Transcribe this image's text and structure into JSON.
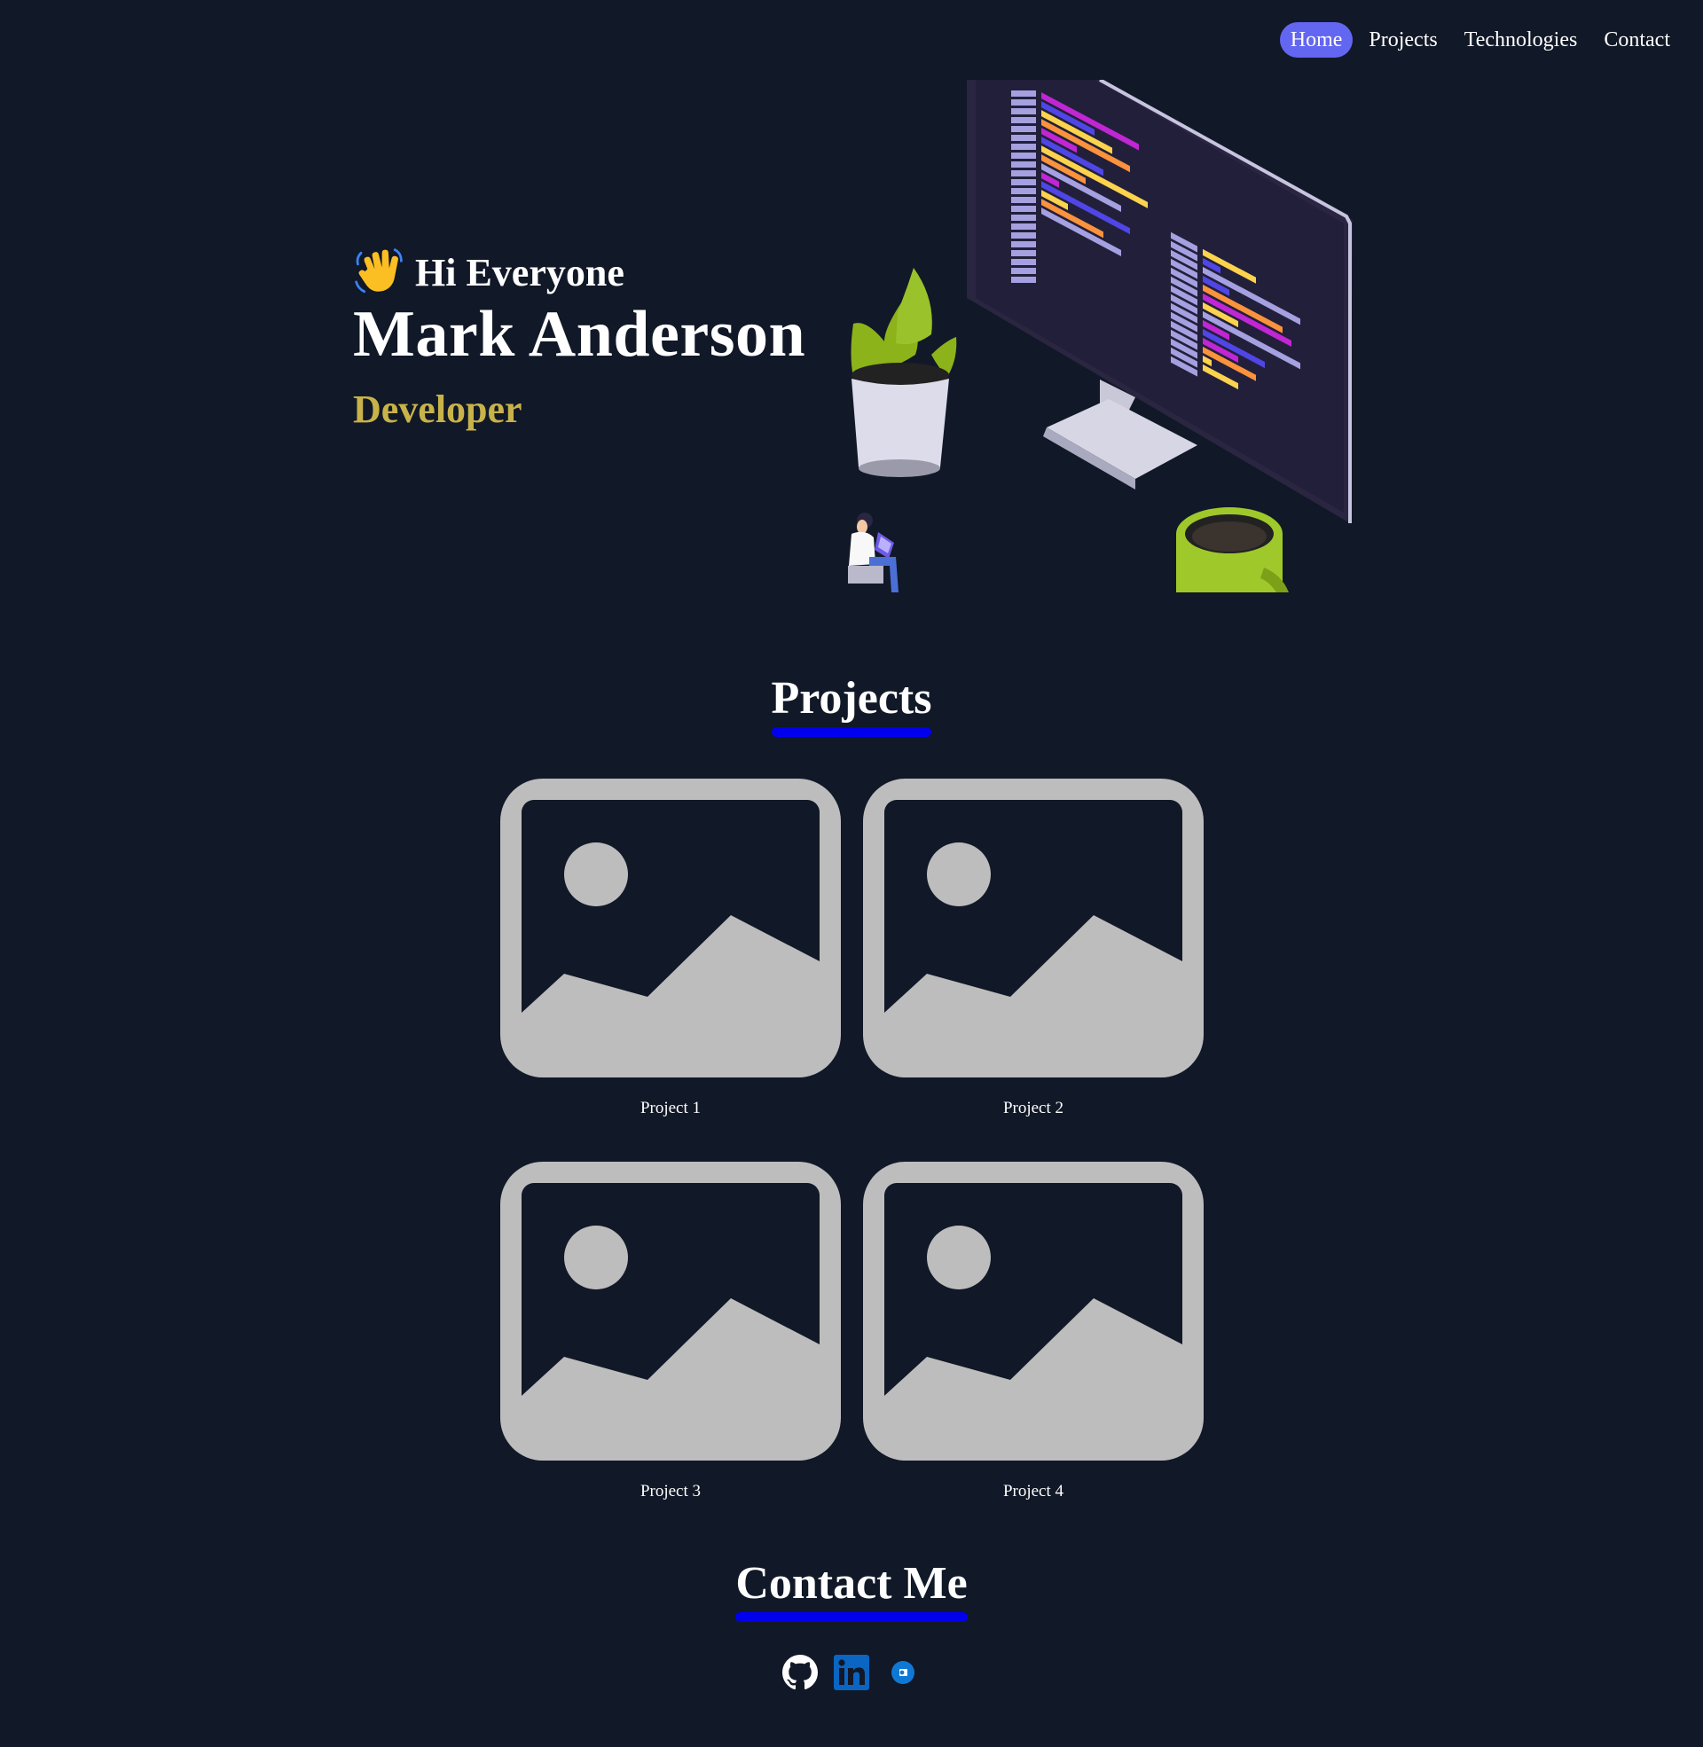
{
  "nav": {
    "items": [
      {
        "label": "Home",
        "active": true
      },
      {
        "label": "Projects",
        "active": false
      },
      {
        "label": "Technologies",
        "active": false
      },
      {
        "label": "Contact",
        "active": false
      }
    ],
    "active_color": "#6366f1"
  },
  "hero": {
    "greeting": "Hi Everyone",
    "wave_icon": "waving-hand-icon",
    "name": "Mark Anderson",
    "role": "Developer",
    "role_color": "#c8b34a",
    "illustration": "developer-workspace-illustration"
  },
  "projects": {
    "title": "Projects",
    "items": [
      {
        "caption": "Project 1",
        "icon": "image-placeholder-icon"
      },
      {
        "caption": "Project 2",
        "icon": "image-placeholder-icon"
      },
      {
        "caption": "Project 3",
        "icon": "image-placeholder-icon"
      },
      {
        "caption": "Project 4",
        "icon": "image-placeholder-icon"
      }
    ]
  },
  "contact": {
    "title": "Contact Me",
    "links": [
      {
        "icon": "github-icon"
      },
      {
        "icon": "linkedin-icon"
      },
      {
        "icon": "outlook-icon"
      }
    ]
  },
  "colors": {
    "background": "#111827",
    "underline": "#0000ee",
    "placeholder": "#bdbdbd"
  }
}
